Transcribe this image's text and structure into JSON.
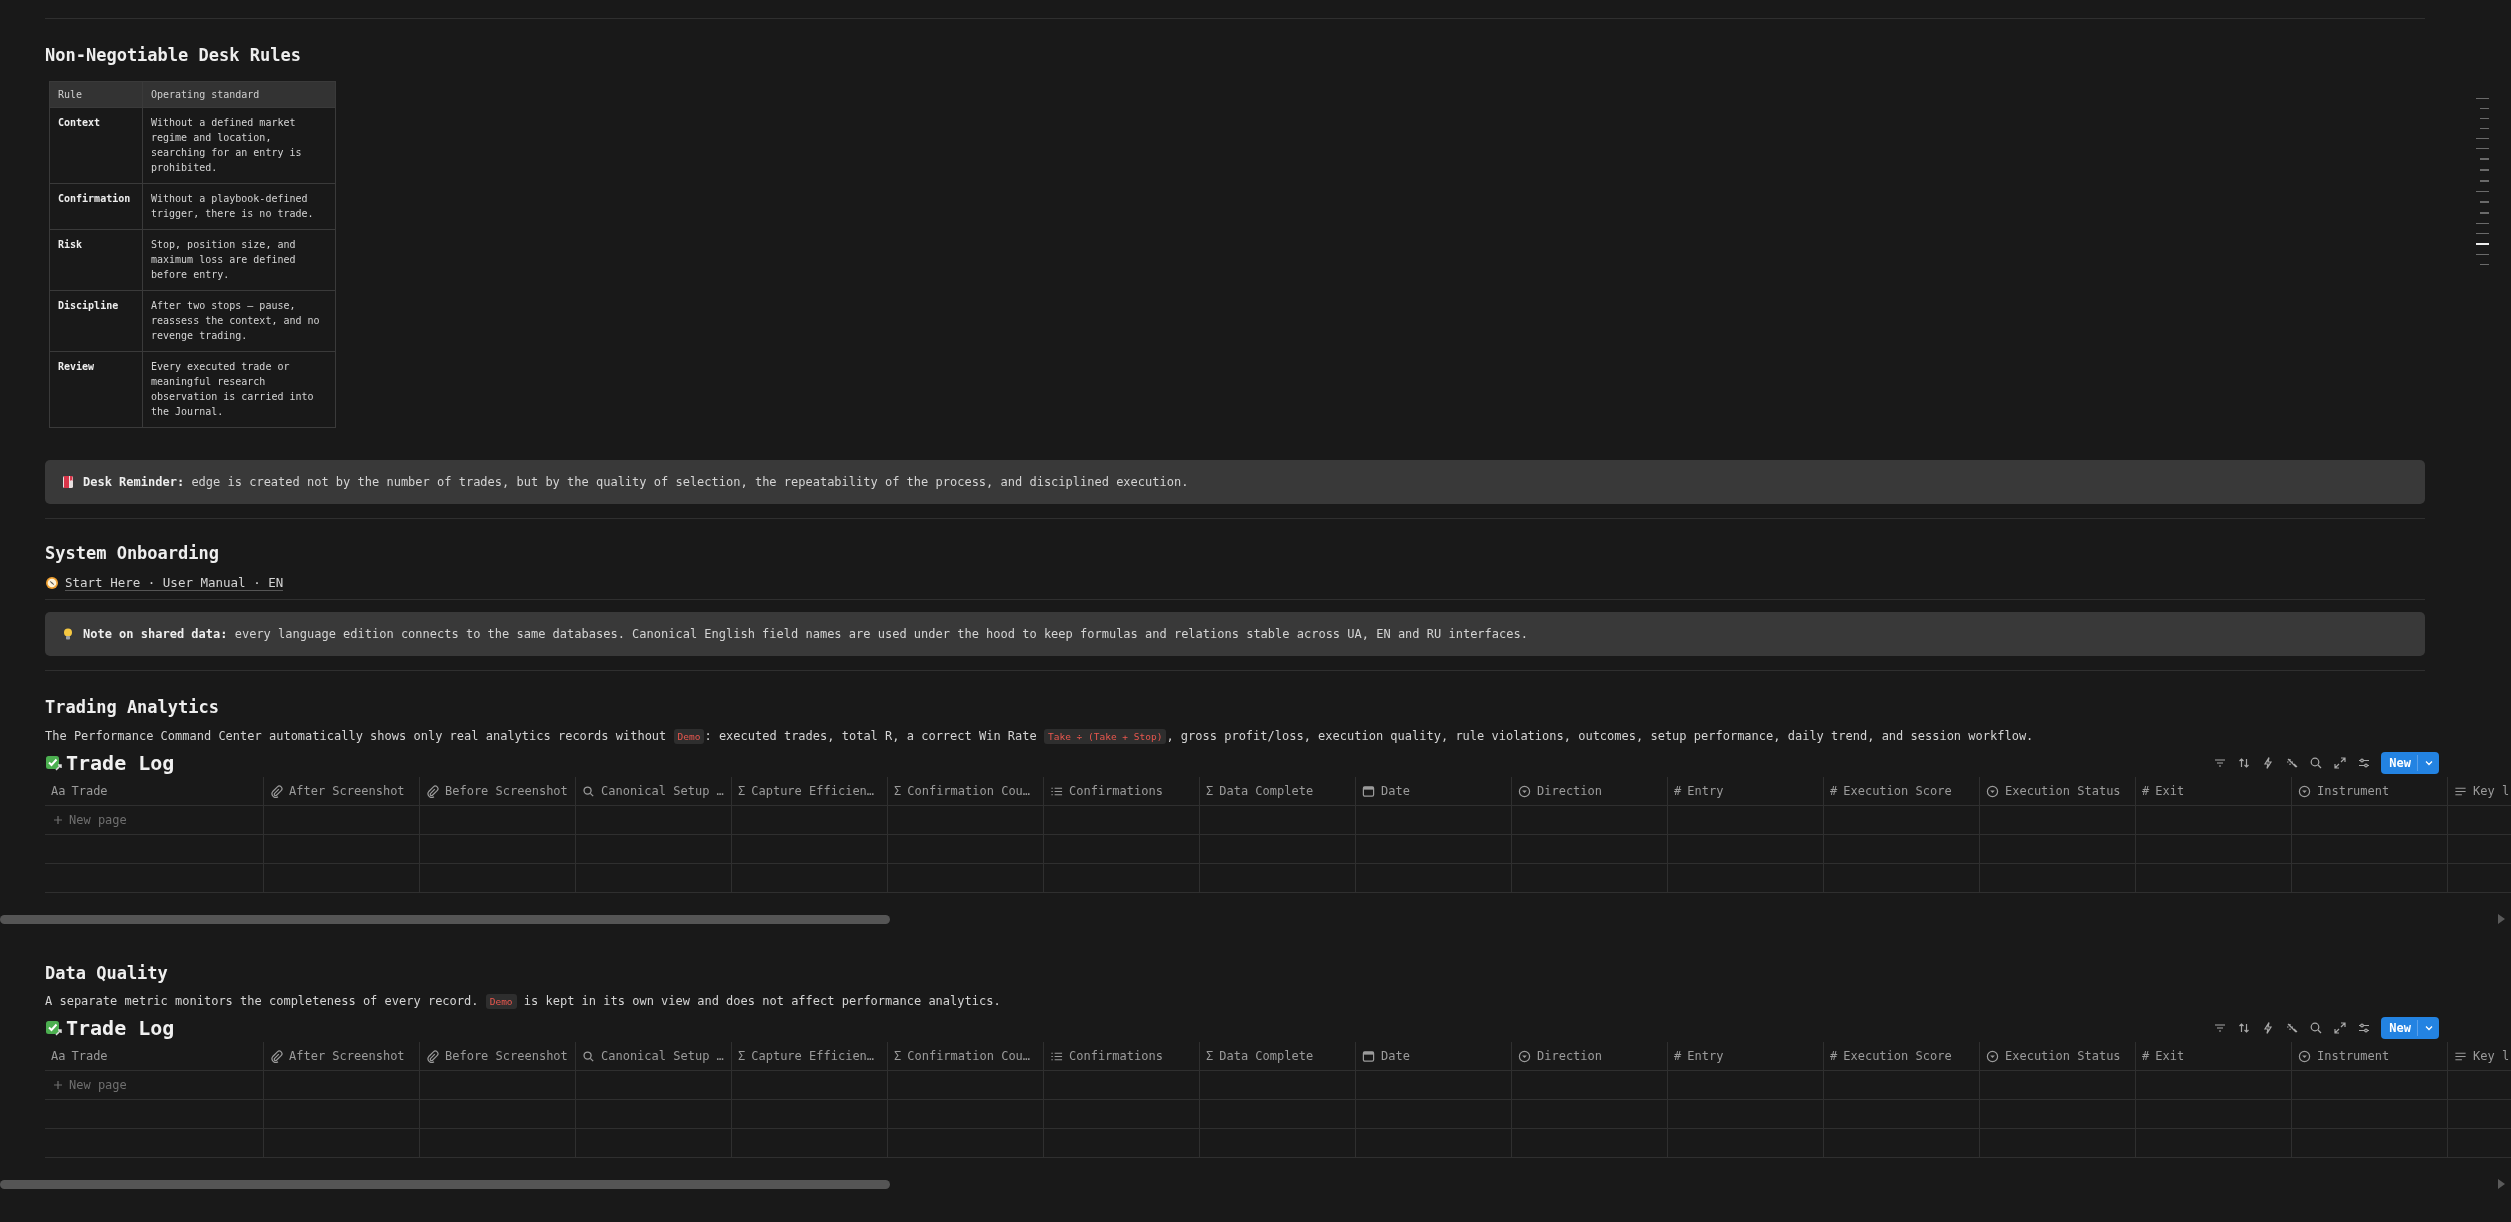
{
  "rules_section": {
    "title": "Non-Negotiable Desk Rules",
    "columns": [
      "Rule",
      "Operating standard"
    ],
    "rows": [
      {
        "rule": "Context",
        "standard": "Without a defined market regime and location, searching for an entry is prohibited."
      },
      {
        "rule": "Confirmation",
        "standard": "Without a playbook-defined trigger, there is no trade."
      },
      {
        "rule": "Risk",
        "standard": "Stop, position size, and maximum loss are defined before entry."
      },
      {
        "rule": "Discipline",
        "standard": "After two stops — pause, reassess the context, and no revenge trading."
      },
      {
        "rule": "Review",
        "standard": "Every executed trade or meaningful research observation is carried into the Journal."
      }
    ]
  },
  "desk_reminder": {
    "text": "**Desk Reminder:** edge is created not by the number of trades, but by the quality of selection, the repeatability of the process, and disciplined execution."
  },
  "onboarding": {
    "title": "System Onboarding",
    "link": "Start Here · User Manual · EN"
  },
  "shared_data_note": {
    "text": "**Note on shared data:** every language edition connects to the same databases. Canonical English field names are used under the hood to keep formulas and relations stable across UA, EN and RU interfaces."
  },
  "sections": [
    {
      "title": "Trading Analytics",
      "description": [
        {
          "kind": "text",
          "text": "The Performance Command Center automatically shows only real analytics records without "
        },
        {
          "kind": "code",
          "text": "Demo"
        },
        {
          "kind": "text",
          "text": ": executed trades, total R, a correct Win Rate "
        },
        {
          "kind": "code",
          "text": "Take ÷ (Take + Stop)"
        },
        {
          "kind": "text",
          "text": ", gross profit/loss, execution quality, rule violations, outcomes, setup performance, daily trend, and session workflow."
        }
      ],
      "database": {
        "title": "Trade Log",
        "new_button": "New",
        "new_row": "New page",
        "columns": [
          {
            "name": "Trade",
            "kind": "title",
            "icon_text": "Aa"
          },
          {
            "name": "After Screenshot",
            "kind": "file"
          },
          {
            "name": "Before Screenshot",
            "kind": "file"
          },
          {
            "name": "Canonical Setup …",
            "kind": "rollup"
          },
          {
            "name": "Capture Efficien…",
            "kind": "formula",
            "icon_text": "Σ"
          },
          {
            "name": "Confirmation Cou…",
            "kind": "formula",
            "icon_text": "Σ"
          },
          {
            "name": "Confirmations",
            "kind": "multi_select"
          },
          {
            "name": "Data Complete",
            "kind": "formula",
            "icon_text": "Σ"
          },
          {
            "name": "Date",
            "kind": "date"
          },
          {
            "name": "Direction",
            "kind": "select"
          },
          {
            "name": "Entry",
            "kind": "number",
            "icon_text": "#"
          },
          {
            "name": "Execution Score",
            "kind": "number",
            "icon_text": "#"
          },
          {
            "name": "Execution Status",
            "kind": "select"
          },
          {
            "name": "Exit",
            "kind": "number",
            "icon_text": "#"
          },
          {
            "name": "Instrument",
            "kind": "select"
          },
          {
            "name": "Key l",
            "kind": "text"
          }
        ]
      }
    },
    {
      "title": "Data Quality",
      "description": [
        {
          "kind": "text",
          "text": "A separate metric monitors the completeness of every record. "
        },
        {
          "kind": "code",
          "text": "Demo"
        },
        {
          "kind": "text",
          "text": " is kept in its own view and does not affect performance analytics."
        }
      ],
      "database": {
        "title": "Trade Log",
        "new_button": "New",
        "new_row": "New page",
        "columns": [
          {
            "name": "Trade",
            "kind": "title",
            "icon_text": "Aa"
          },
          {
            "name": "After Screenshot",
            "kind": "file"
          },
          {
            "name": "Before Screenshot",
            "kind": "file"
          },
          {
            "name": "Canonical Setup …",
            "kind": "rollup"
          },
          {
            "name": "Capture Efficien…",
            "kind": "formula",
            "icon_text": "Σ"
          },
          {
            "name": "Confirmation Cou…",
            "kind": "formula",
            "icon_text": "Σ"
          },
          {
            "name": "Confirmations",
            "kind": "multi_select"
          },
          {
            "name": "Data Complete",
            "kind": "formula",
            "icon_text": "Σ"
          },
          {
            "name": "Date",
            "kind": "date"
          },
          {
            "name": "Direction",
            "kind": "select"
          },
          {
            "name": "Entry",
            "kind": "number",
            "icon_text": "#"
          },
          {
            "name": "Execution Score",
            "kind": "number",
            "icon_text": "#"
          },
          {
            "name": "Execution Status",
            "kind": "select"
          },
          {
            "name": "Exit",
            "kind": "number",
            "icon_text": "#"
          },
          {
            "name": "Instrument",
            "kind": "select"
          },
          {
            "name": "Key l",
            "kind": "text"
          }
        ]
      }
    }
  ]
}
